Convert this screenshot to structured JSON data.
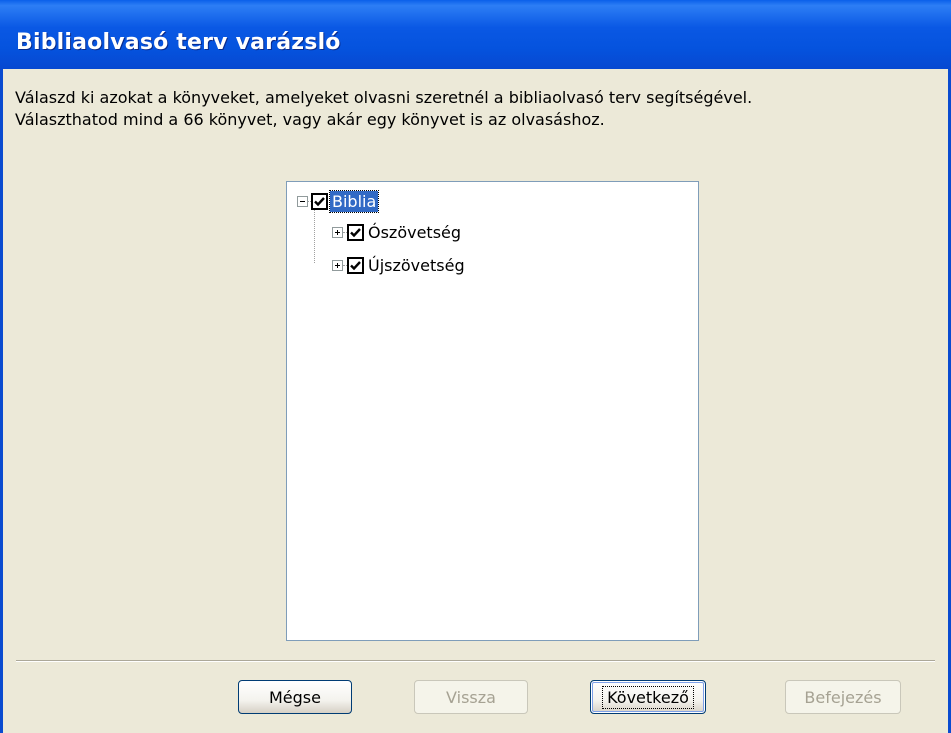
{
  "window": {
    "title": "Bibliaolvasó terv varázsló"
  },
  "instructions": {
    "line1": "Válaszd ki azokat a könyveket, amelyeket olvasni szeretnél a bibliaolvasó terv segítségével.",
    "line2": "Választhatod mind a 66 könyvet, vagy akár egy könyvet is az olvasáshoz."
  },
  "tree": {
    "root": {
      "label": "Biblia",
      "checked": true,
      "expanded": true,
      "selected": true,
      "icon": "minus-expander-icon"
    },
    "children": [
      {
        "label": "Ószövetség",
        "checked": true,
        "expanded": false,
        "icon": "plus-expander-icon"
      },
      {
        "label": "Újszövetség",
        "checked": true,
        "expanded": false,
        "icon": "plus-expander-icon"
      }
    ]
  },
  "buttons": {
    "cancel": {
      "label": "Mégse",
      "enabled": true
    },
    "back": {
      "label": "Vissza",
      "enabled": false
    },
    "next": {
      "label": "Következő",
      "enabled": true,
      "default": true
    },
    "finish": {
      "label": "Befejezés",
      "enabled": false
    }
  },
  "colors": {
    "titlebar": "#0553DE",
    "dialog_background": "#ECE9D8",
    "selection": "#316AC5"
  }
}
